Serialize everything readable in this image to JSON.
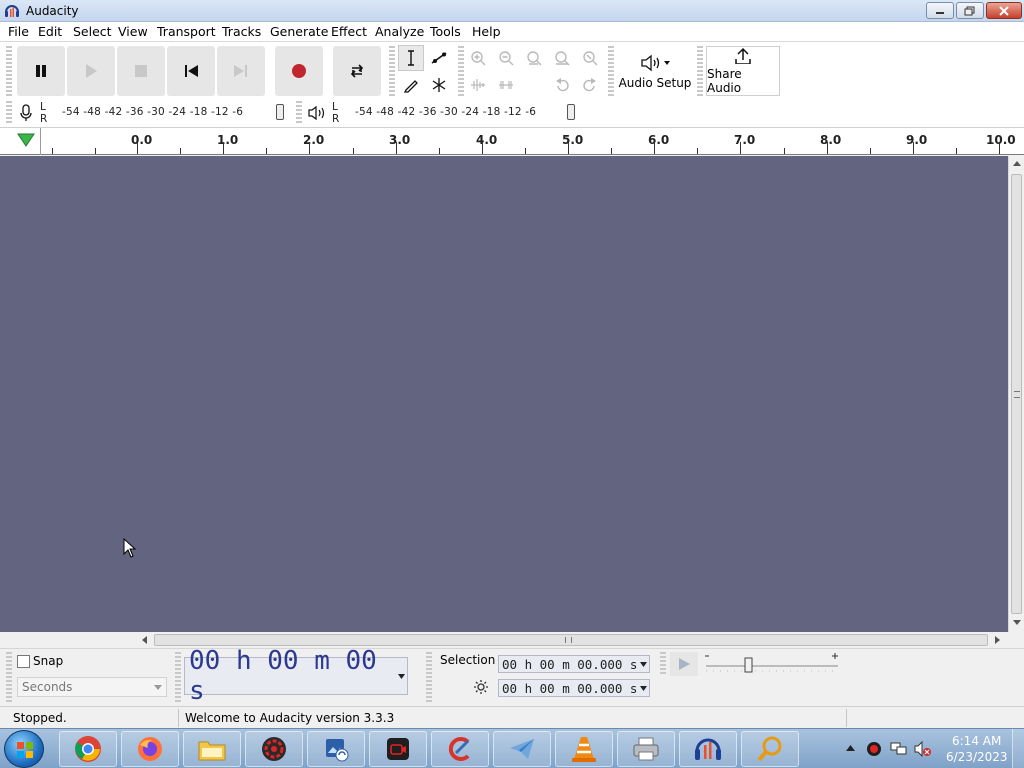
{
  "window": {
    "title": "Audacity"
  },
  "menu": [
    "File",
    "Edit",
    "Select",
    "View",
    "Transport",
    "Tracks",
    "Generate",
    "Effect",
    "Analyze",
    "Tools",
    "Help"
  ],
  "toolbar": {
    "audio_setup_label": "Audio Setup",
    "share_audio_label": "Share Audio"
  },
  "meters": {
    "rec_l": "L",
    "rec_r": "R",
    "play_l": "L",
    "play_r": "R",
    "rec_ticks": "-54  -48  -42  -36  -30  -24  -18  -12   -6",
    "play_ticks": "-54  -48  -42  -36  -30  -24  -18  -12   -6"
  },
  "ruler": {
    "labels": [
      "0.0",
      "1.0",
      "2.0",
      "3.0",
      "4.0",
      "5.0",
      "6.0",
      "7.0",
      "8.0",
      "9.0",
      "10.0"
    ]
  },
  "bottom": {
    "snap_label": "Snap",
    "snap_unit": "Seconds",
    "time_display": "00 h 00 m 00 s",
    "selection_label": "Selection",
    "selection_start": "00 h 00 m 00.000 s",
    "selection_end": "00 h 00 m 00.000 s"
  },
  "status": {
    "state": "Stopped.",
    "message": "Welcome to Audacity version 3.3.3"
  },
  "taskbar": {
    "time": "6:14 AM",
    "date": "6/23/2023"
  },
  "colors": {
    "track_bg": "#636580",
    "record_red": "#c0262d",
    "time_blue": "#2c3990"
  }
}
